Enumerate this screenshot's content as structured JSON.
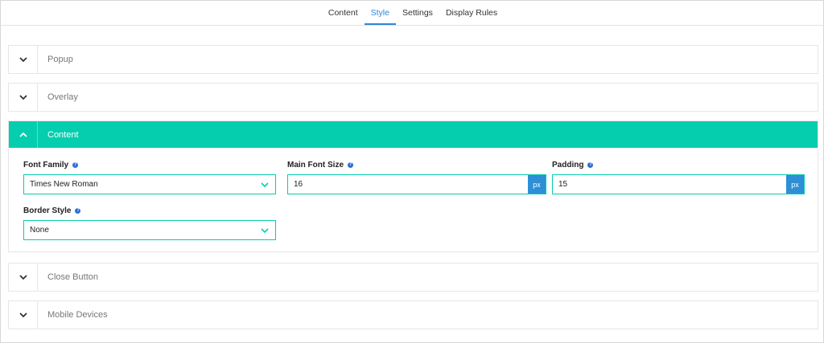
{
  "tabs": [
    {
      "label": "Content"
    },
    {
      "label": "Style"
    },
    {
      "label": "Settings"
    },
    {
      "label": "Display Rules"
    }
  ],
  "sections": {
    "popup": {
      "title": "Popup"
    },
    "overlay": {
      "title": "Overlay"
    },
    "content": {
      "title": "Content"
    },
    "close_button": {
      "title": "Close Button"
    },
    "mobile_devices": {
      "title": "Mobile Devices"
    }
  },
  "content_panel": {
    "font_family": {
      "label": "Font Family",
      "value": "Times New Roman",
      "help_icon": "help-icon"
    },
    "main_font_size": {
      "label": "Main Font Size",
      "value": "16",
      "unit": "px",
      "help_icon": "help-icon"
    },
    "padding": {
      "label": "Padding",
      "value": "15",
      "unit": "px",
      "help_icon": "help-icon"
    },
    "border_style": {
      "label": "Border Style",
      "value": "None",
      "help_icon": "help-icon"
    }
  },
  "colors": {
    "accent_teal": "#04ceae",
    "active_tab": "#2b88d8",
    "unit_blue": "#2d8fd5"
  }
}
